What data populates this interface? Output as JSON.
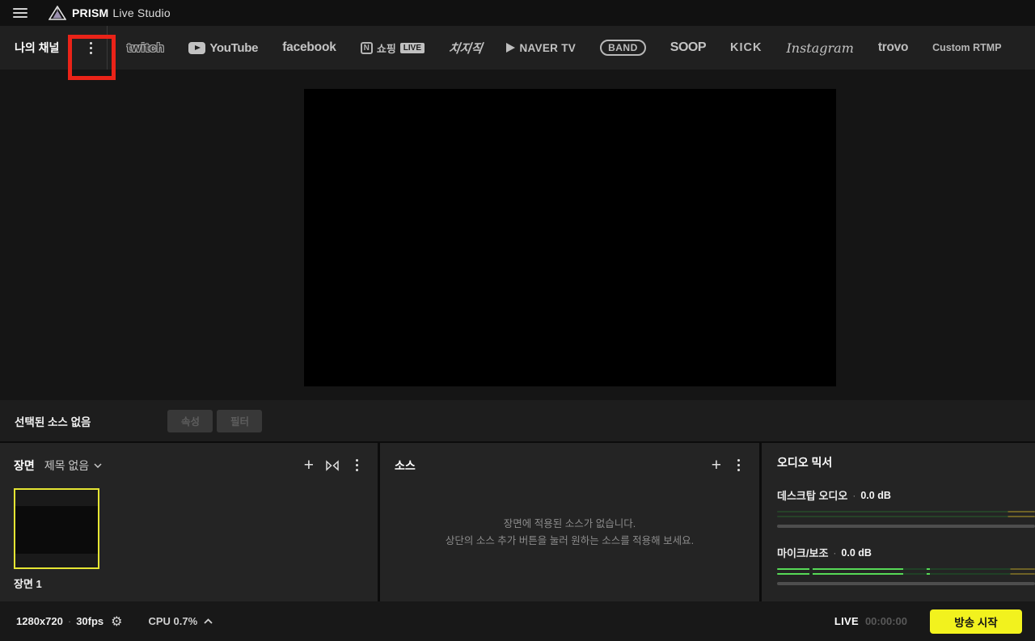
{
  "app": {
    "brand_bold": "PRISM",
    "brand_rest": "Live Studio"
  },
  "channel_bar": {
    "my_channel_label": "나의 채널",
    "platforms": [
      {
        "label": "twitch"
      },
      {
        "label": "YouTube"
      },
      {
        "label": "facebook"
      },
      {
        "prefix": "N",
        "label": "쇼핑",
        "badge": "LIVE"
      },
      {
        "label": "치지직"
      },
      {
        "label": "NAVER TV"
      },
      {
        "label": "BAND"
      },
      {
        "label": "SOOP"
      },
      {
        "label": "KICK"
      },
      {
        "label": "Instagram"
      },
      {
        "label": "trovo"
      },
      {
        "label": "Custom RTMP"
      }
    ]
  },
  "source_toolbar": {
    "no_source_label": "선택된 소스 없음",
    "properties_button": "속성",
    "filter_button": "필터"
  },
  "scene_panel": {
    "title": "장면",
    "scene_selector": "제목 없음",
    "scenes": [
      {
        "label": "장면 1"
      }
    ]
  },
  "source_panel": {
    "title": "소스",
    "empty_line1": "장면에 적용된 소스가 없습니다.",
    "empty_line2": "상단의 소스 추가 버튼을 눌러 원하는 소스를 적용해 보세요."
  },
  "audio_mixer": {
    "title": "오디오 믹서",
    "channels": [
      {
        "name": "데스크탑 오디오",
        "separator": "·",
        "level": "0.0 dB"
      },
      {
        "name": "마이크/보조",
        "separator": "·",
        "level": "0.0 dB"
      }
    ]
  },
  "status_bar": {
    "resolution": "1280x720",
    "separator": "·",
    "fps": "30fps",
    "cpu": "CPU 0.7%",
    "live_label": "LIVE",
    "live_time": "00:00:00",
    "start_button": "방송 시작"
  },
  "colors": {
    "accent_yellow": "#f2f21e",
    "scene_border_yellow": "#e5e533",
    "annotation_red": "#ea2318",
    "meter_green": "#57d957",
    "meter_dark_green": "#264228",
    "meter_dark_yellow": "#6e6226"
  }
}
